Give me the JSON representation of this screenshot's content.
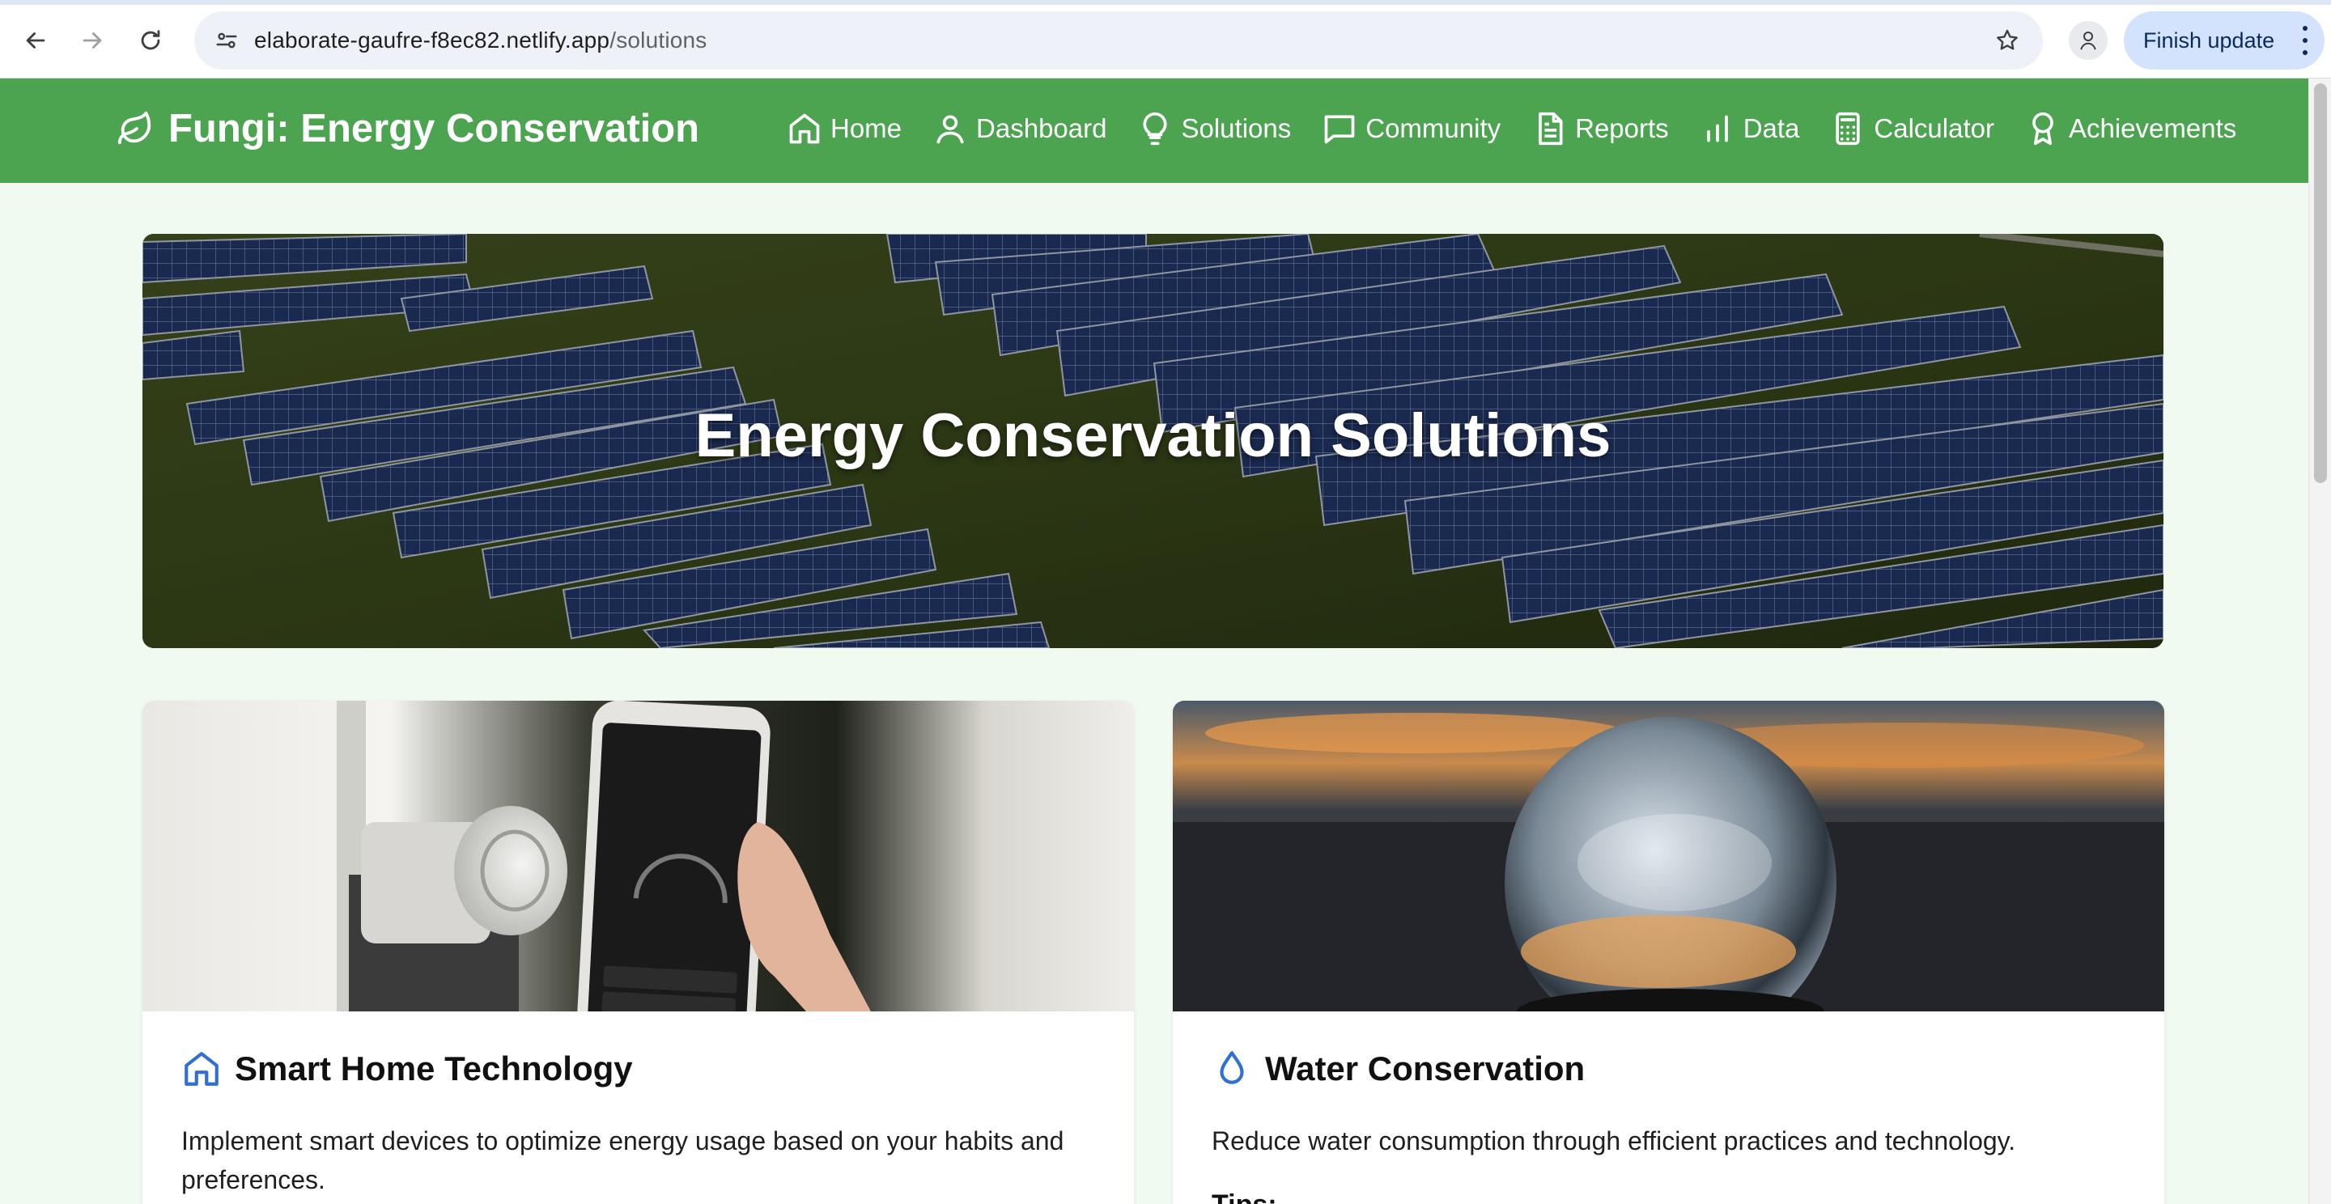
{
  "browser": {
    "url_host": "elaborate-gaufre-f8ec82.netlify.app",
    "url_path": "/solutions",
    "finish_update_label": "Finish update",
    "icons": [
      "back-arrow-icon",
      "forward-arrow-icon",
      "reload-icon",
      "site-settings-icon",
      "bookmark-star-icon",
      "extension-icon",
      "more-menu-icon"
    ]
  },
  "header": {
    "brand": "Fungi: Energy Conservation",
    "brand_icon": "leaf-icon",
    "nav": [
      {
        "label": "Home",
        "icon": "home-icon"
      },
      {
        "label": "Dashboard",
        "icon": "user-icon"
      },
      {
        "label": "Solutions",
        "icon": "lightbulb-icon"
      },
      {
        "label": "Community",
        "icon": "chat-bubble-icon"
      },
      {
        "label": "Reports",
        "icon": "document-icon"
      },
      {
        "label": "Data",
        "icon": "bar-chart-icon"
      },
      {
        "label": "Calculator",
        "icon": "calculator-icon"
      },
      {
        "label": "Achievements",
        "icon": "award-icon"
      }
    ]
  },
  "hero": {
    "title": "Energy Conservation Solutions",
    "image": "solar-panel-field-photo"
  },
  "cards": [
    {
      "title": "Smart Home Technology",
      "icon": "home-icon",
      "image": "smart-lock-phone-photo",
      "description": "Implement smart devices to optimize energy usage based on your habits and preferences."
    },
    {
      "title": "Water Conservation",
      "icon": "water-drop-icon",
      "image": "crystal-ball-sunset-photo",
      "description": "Reduce water consumption through efficient practices and technology.",
      "tips_label": "Tips:"
    }
  ],
  "colors": {
    "header_green": "#4ca350",
    "page_bg": "#f0faf1",
    "icon_blue": "#2f6fd6",
    "update_chip": "#d3e3fd"
  }
}
